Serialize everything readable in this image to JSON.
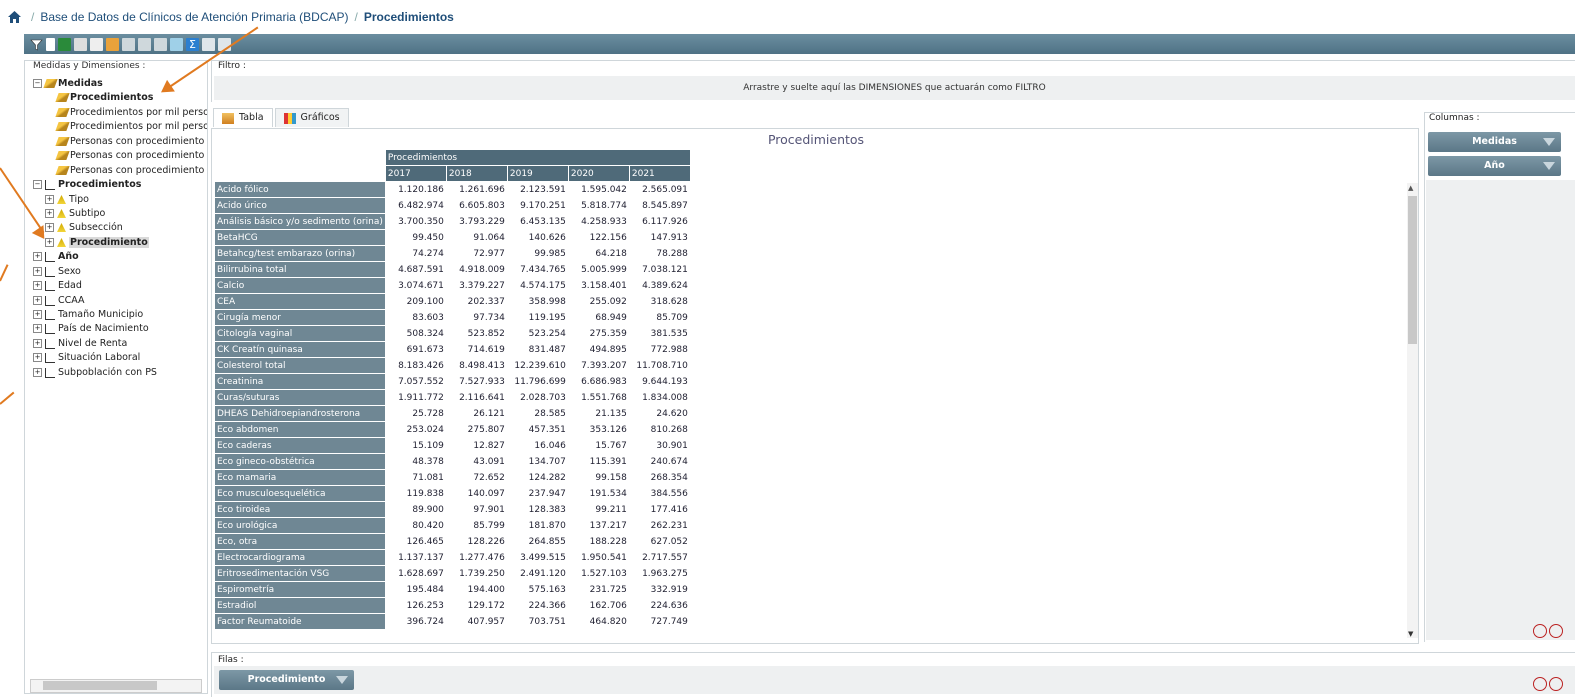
{
  "breadcrumb": {
    "home_icon": "home-icon",
    "item1": "Base de Datos de Clínicos de Atención Primaria (BDCAP)",
    "sep": "/",
    "current": "Procedimientos"
  },
  "left_panel": {
    "legend": "Medidas y Dimensiones :",
    "items": [
      {
        "label": "Medidas"
      },
      {
        "label": "Procedimientos"
      },
      {
        "label": "Procedimientos por mil personas a"
      },
      {
        "label": "Procedimientos por mil personas a"
      },
      {
        "label": "Personas con procedimiento"
      },
      {
        "label": "Personas con procedimiento por n"
      },
      {
        "label": "Personas con procedimiento por n"
      },
      {
        "label": "Procedimientos"
      },
      {
        "label": "Tipo"
      },
      {
        "label": "Subtipo"
      },
      {
        "label": "Subsección"
      },
      {
        "label": "Procedimiento"
      },
      {
        "label": "Año"
      },
      {
        "label": "Sexo"
      },
      {
        "label": "Edad"
      },
      {
        "label": "CCAA"
      },
      {
        "label": "Tamaño Municipio"
      },
      {
        "label": "País de Nacimiento"
      },
      {
        "label": "Nivel de Renta"
      },
      {
        "label": "Situación Laboral"
      },
      {
        "label": "Subpoblación con PS"
      }
    ]
  },
  "filter": {
    "legend": "Filtro :",
    "drop_text": "Arrastre y suelte aquí las DIMENSIONES que actuarán como FILTRO"
  },
  "tabs": {
    "tabla": "Tabla",
    "graficos": "Gráficos"
  },
  "table": {
    "title": "Procedimientos",
    "measure_header": "Procedimientos",
    "years": [
      "2017",
      "2018",
      "2019",
      "2020",
      "2021"
    ],
    "rows": [
      {
        "name": "Acido fólico",
        "v": [
          "1.120.186",
          "1.261.696",
          "2.123.591",
          "1.595.042",
          "2.565.091"
        ]
      },
      {
        "name": "Acido úrico",
        "v": [
          "6.482.974",
          "6.605.803",
          "9.170.251",
          "5.818.774",
          "8.545.897"
        ]
      },
      {
        "name": "Análisis básico y/o sedimento (orina)",
        "v": [
          "3.700.350",
          "3.793.229",
          "6.453.135",
          "4.258.933",
          "6.117.926"
        ]
      },
      {
        "name": "BetaHCG",
        "v": [
          "99.450",
          "91.064",
          "140.626",
          "122.156",
          "147.913"
        ]
      },
      {
        "name": "Betahcg/test embarazo (orina)",
        "v": [
          "74.274",
          "72.977",
          "99.985",
          "64.218",
          "78.288"
        ]
      },
      {
        "name": "Bilirrubina total",
        "v": [
          "4.687.591",
          "4.918.009",
          "7.434.765",
          "5.005.999",
          "7.038.121"
        ]
      },
      {
        "name": "Calcio",
        "v": [
          "3.074.671",
          "3.379.227",
          "4.574.175",
          "3.158.401",
          "4.389.624"
        ]
      },
      {
        "name": "CEA",
        "v": [
          "209.100",
          "202.337",
          "358.998",
          "255.092",
          "318.628"
        ]
      },
      {
        "name": "Cirugía menor",
        "v": [
          "83.603",
          "97.734",
          "119.195",
          "68.949",
          "85.709"
        ]
      },
      {
        "name": "Citología vaginal",
        "v": [
          "508.324",
          "523.852",
          "523.254",
          "275.359",
          "381.535"
        ]
      },
      {
        "name": "CK Creatín quinasa",
        "v": [
          "691.673",
          "714.619",
          "831.487",
          "494.895",
          "772.988"
        ]
      },
      {
        "name": "Colesterol total",
        "v": [
          "8.183.426",
          "8.498.413",
          "12.239.610",
          "7.393.207",
          "11.708.710"
        ]
      },
      {
        "name": "Creatinina",
        "v": [
          "7.057.552",
          "7.527.933",
          "11.796.699",
          "6.686.983",
          "9.644.193"
        ]
      },
      {
        "name": "Curas/suturas",
        "v": [
          "1.911.772",
          "2.116.641",
          "2.028.703",
          "1.551.768",
          "1.834.008"
        ]
      },
      {
        "name": "DHEAS Dehidroepiandrosterona",
        "v": [
          "25.728",
          "26.121",
          "28.585",
          "21.135",
          "24.620"
        ]
      },
      {
        "name": "Eco abdomen",
        "v": [
          "253.024",
          "275.807",
          "457.351",
          "353.126",
          "810.268"
        ]
      },
      {
        "name": "Eco caderas",
        "v": [
          "15.109",
          "12.827",
          "16.046",
          "15.767",
          "30.901"
        ]
      },
      {
        "name": "Eco gineco-obstétrica",
        "v": [
          "48.378",
          "43.091",
          "134.707",
          "115.391",
          "240.674"
        ]
      },
      {
        "name": "Eco mamaria",
        "v": [
          "71.081",
          "72.652",
          "124.282",
          "99.158",
          "268.354"
        ]
      },
      {
        "name": "Eco musculoesquelética",
        "v": [
          "119.838",
          "140.097",
          "237.947",
          "191.534",
          "384.556"
        ]
      },
      {
        "name": "Eco tiroidea",
        "v": [
          "89.900",
          "97.901",
          "128.383",
          "99.211",
          "177.416"
        ]
      },
      {
        "name": "Eco urológica",
        "v": [
          "80.420",
          "85.799",
          "181.870",
          "137.217",
          "262.231"
        ]
      },
      {
        "name": "Eco, otra",
        "v": [
          "126.465",
          "128.226",
          "264.855",
          "188.228",
          "627.052"
        ]
      },
      {
        "name": "Electrocardiograma",
        "v": [
          "1.137.137",
          "1.277.476",
          "3.499.515",
          "1.950.541",
          "2.717.557"
        ]
      },
      {
        "name": "Eritrosedimentación VSG",
        "v": [
          "1.628.697",
          "1.739.250",
          "2.491.120",
          "1.527.103",
          "1.963.275"
        ]
      },
      {
        "name": "Espirometría",
        "v": [
          "195.484",
          "194.400",
          "575.163",
          "231.725",
          "332.919"
        ]
      },
      {
        "name": "Estradiol",
        "v": [
          "126.253",
          "129.172",
          "224.366",
          "162.706",
          "224.636"
        ]
      },
      {
        "name": "Factor Reumatoide",
        "v": [
          "396.724",
          "407.957",
          "703.751",
          "464.820",
          "727.749"
        ]
      }
    ]
  },
  "columns_panel": {
    "legend": "Columnas :",
    "buttons": [
      "Medidas",
      "Año"
    ]
  },
  "rows_panel": {
    "legend": "Filas :",
    "button": "Procedimiento"
  },
  "colors": {
    "accent": "#e07a20",
    "header": "#4f6a79",
    "rowheader": "#6f8794"
  }
}
